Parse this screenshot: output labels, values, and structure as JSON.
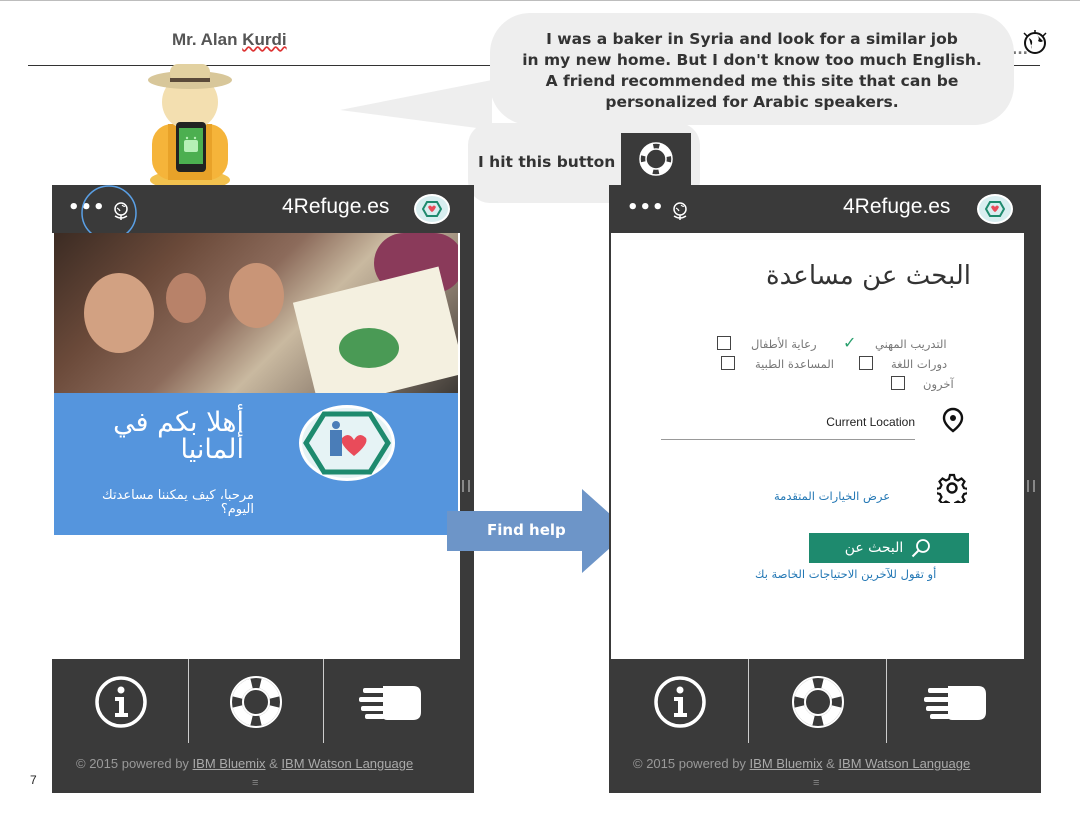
{
  "slide": {
    "speaker_name_first": "Mr. Alan ",
    "speaker_name_last": "Kurdi",
    "slide_number": "7"
  },
  "bubble_main": {
    "lines": [
      "I was a baker in Syria and look for a similar job",
      "in my new home. But I don't know too much English.",
      "A friend recommended me this site that can be",
      "personalized for Arabic speakers."
    ]
  },
  "bubble_hit": {
    "text": "I hit this button",
    "button_icon": "lifebuoy-icon"
  },
  "arrow": {
    "label": "Find help",
    "color": "#6d95c8"
  },
  "app": {
    "brand": "4Refuge.es",
    "menu_dots": "•••",
    "footer_prefix": "© 2015 powered by ",
    "footer_link1": "IBM Bluemix",
    "footer_amp": " & ",
    "footer_link2": "IBM Watson Language",
    "footer_grip": "≡",
    "tabs": [
      {
        "icon": "info-icon"
      },
      {
        "icon": "lifebuoy-icon"
      },
      {
        "icon": "hand-icon"
      }
    ],
    "header_bg": "#3a3a3a",
    "accent_blue": "#5595dd",
    "accent_green": "#1e8a6e"
  },
  "home_screen": {
    "welcome_title": "أهلا بكم في ألمانيا",
    "welcome_subtitle": "مرحبا، كيف يمكننا مساعدتك اليوم؟"
  },
  "help_screen": {
    "title": "البحث عن مساعدة",
    "options": [
      {
        "label": "التدريب المهني",
        "checked": true
      },
      {
        "label": "رعاية الأطفال",
        "checked": false
      },
      {
        "label": "دورات اللغة",
        "checked": false
      },
      {
        "label": "المساعدة الطبية",
        "checked": false
      },
      {
        "label": "آخرون",
        "checked": false
      }
    ],
    "location_value": "Current Location",
    "advanced_link": "عرض الخيارات المتقدمة",
    "search_button": "البحث عن",
    "needs_link": "أو تقول للآخرين الاحتياجات الخاصة بك"
  }
}
